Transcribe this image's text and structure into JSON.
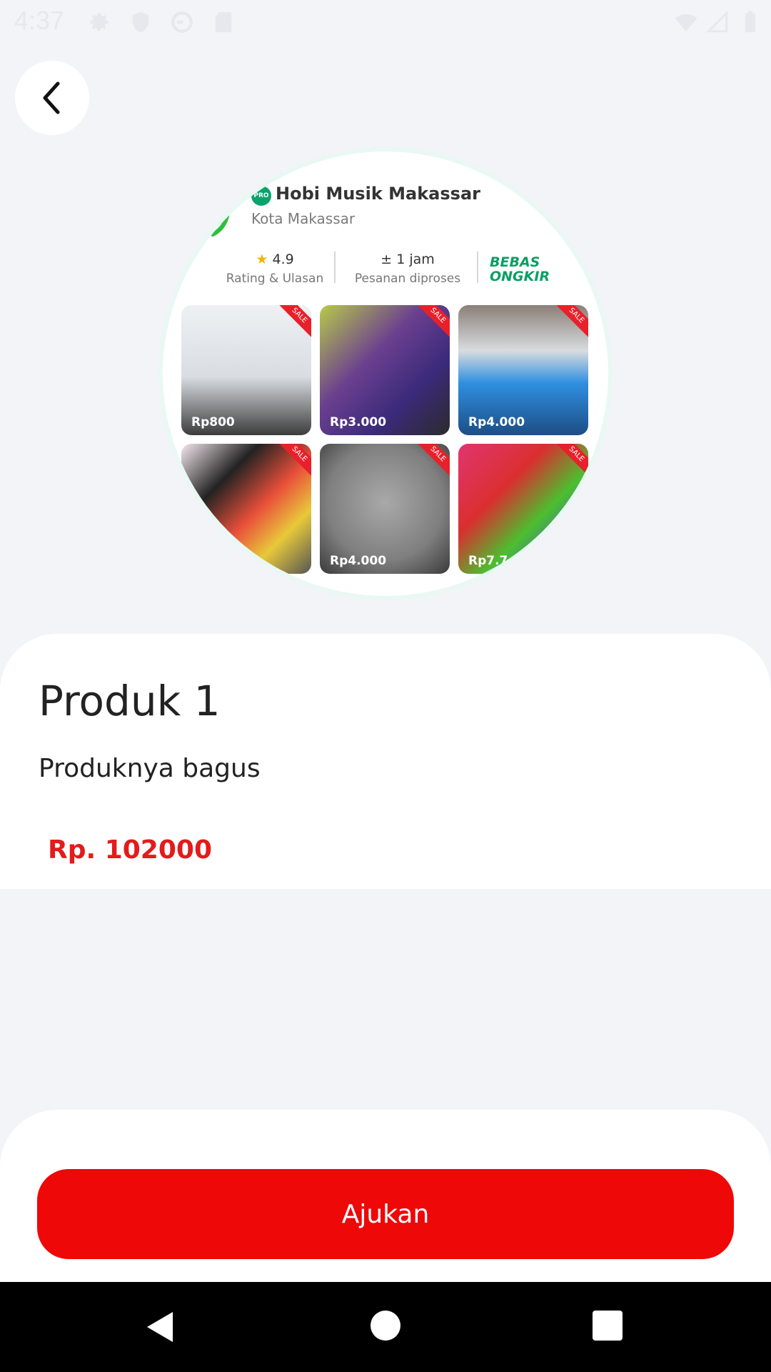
{
  "status_bar": {
    "time": "4:37",
    "left_icons": [
      "gear-icon",
      "shield-icon",
      "sync-icon",
      "sd-card-icon"
    ],
    "right_icons": [
      "wifi-icon",
      "signal-icon",
      "battery-icon"
    ]
  },
  "header": {
    "back_icon": "arrow-left-icon"
  },
  "product_image": {
    "store_name": "Hobi Musik Makassar",
    "pro_label": "PRO",
    "store_city": "Kota Makassar",
    "rating_value": "4.9",
    "rating_label": "Rating & Ulasan",
    "process_value": "± 1 jam",
    "process_label": "Pesanan diproses",
    "shipping_badge_line1": "BEBAS",
    "shipping_badge_line2": "ONGKIR",
    "tiles": [
      {
        "price": "Rp800",
        "sale": "SALE"
      },
      {
        "price": "Rp3.000",
        "sale": "SALE"
      },
      {
        "price": "Rp4.000",
        "sale": "SALE"
      },
      {
        "price": "",
        "sale": "SALE"
      },
      {
        "price": "Rp4.000",
        "sale": "SALE"
      },
      {
        "price": "Rp7.7",
        "sale": "SALE"
      }
    ]
  },
  "product": {
    "title": "Produk 1",
    "description": "Produknya bagus",
    "price": "Rp. 102000"
  },
  "action": {
    "submit_label": "Ajukan"
  },
  "colors": {
    "accent": "#ef0808",
    "price": "#e31b1b",
    "background": "#f3f4f8"
  }
}
